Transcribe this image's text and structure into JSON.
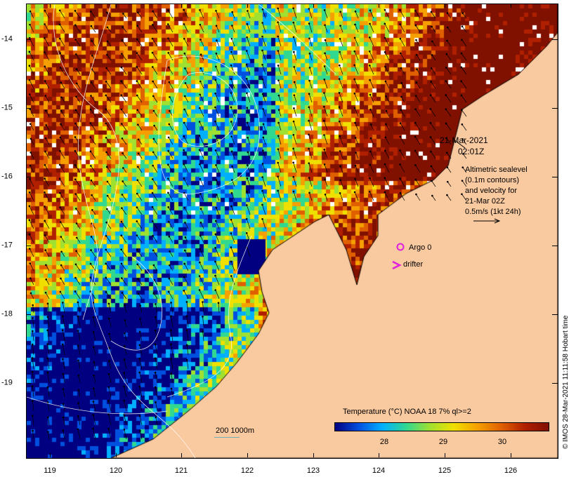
{
  "map": {
    "longitude_labels": [
      "119",
      "120",
      "121",
      "122",
      "123",
      "124",
      "125",
      "126"
    ],
    "latitude_labels": [
      "-14",
      "-15",
      "-16",
      "-17",
      "-18",
      "-19"
    ],
    "colors": {
      "land": "#f9c9a0",
      "no_data": "#ffffff",
      "contour": "#ffffff",
      "vector": "#000000",
      "argo": "#e020e0",
      "drifter": "#e020e0"
    }
  },
  "info": {
    "date": "21-Mar-2021",
    "time": "02:01Z",
    "notes": [
      "Altimetric sealevel",
      "(0.1m contours)",
      "and velocity for",
      "21-Mar 02Z",
      "0.5m/s (1kt 24h)"
    ]
  },
  "legend": {
    "argo_label": "Argo 0",
    "drifter_label": "drifter"
  },
  "colorbar": {
    "title": "Temperature (°C) NOAA 18 7% ql>=2",
    "tick_labels": [
      "28",
      "29",
      "30"
    ],
    "colors": [
      "#000080",
      "#0050e0",
      "#00b0ff",
      "#30d890",
      "#a0e030",
      "#f0e000",
      "#f5a000",
      "#e06000",
      "#b02000",
      "#801000"
    ]
  },
  "scale": {
    "label": "200  1000m"
  },
  "credit": "© IMOS 28-Mar-2021 11:11:58 Hobart time"
}
